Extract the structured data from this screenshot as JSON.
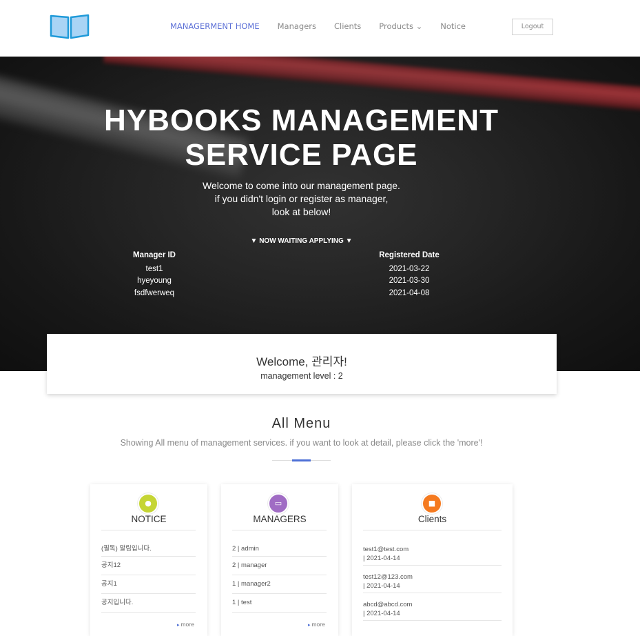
{
  "nav": {
    "logo": "book-logo",
    "items": [
      {
        "label": "MANAGERMENT HOME",
        "active": true
      },
      {
        "label": "Managers",
        "active": false
      },
      {
        "label": "Clients",
        "active": false
      },
      {
        "label": "Products ⌄",
        "active": false
      },
      {
        "label": "Notice",
        "active": false
      }
    ],
    "logout": "Logout"
  },
  "hero": {
    "title_line1": "HYBOOKS MANAGEMENT",
    "title_line2": "SERVICE PAGE",
    "sub_line1": "Welcome to come into our management page.",
    "sub_line2": "if you didn't login or register as manager,",
    "sub_line3": "look at below!",
    "waiting": "▼ NOW WAITING APPLYING ▼",
    "col_id_header": "Manager ID",
    "col_date_header": "Registered Date",
    "rows": [
      {
        "id": "test1",
        "date": "2021-03-22"
      },
      {
        "id": "hyeyoung",
        "date": "2021-03-30"
      },
      {
        "id": "fsdfwerweq",
        "date": "2021-04-08"
      }
    ]
  },
  "welcome": {
    "greeting": "Welcome, 관리자!",
    "level": "management level : 2"
  },
  "allmenu": {
    "title": "All Menu",
    "subtitle": "Showing All menu of management services. if you want to look at detail, please click the 'more'!"
  },
  "cards": {
    "notice": {
      "title": "NOTICE",
      "icon": "bell-icon",
      "color": "#c5d534",
      "items": [
        "(필독) 알림입니다.",
        "공지12",
        "공지1",
        "공지입니다."
      ],
      "more": "more"
    },
    "managers": {
      "title": "MANAGERS",
      "icon": "laptop-icon",
      "color": "#a06cc4",
      "items": [
        "2 | admin",
        "2 | manager",
        "1 | manager2",
        "1 | test"
      ],
      "more": "more"
    },
    "clients": {
      "title": "Clients",
      "icon": "briefcase-icon",
      "color": "#f57a1f",
      "items": [
        {
          "email": "test1@test.com",
          "date": "| 2021-04-14"
        },
        {
          "email": "test12@123.com",
          "date": "| 2021-04-14"
        },
        {
          "email": "abcd@abcd.com",
          "date": "| 2021-04-14"
        }
      ]
    }
  }
}
